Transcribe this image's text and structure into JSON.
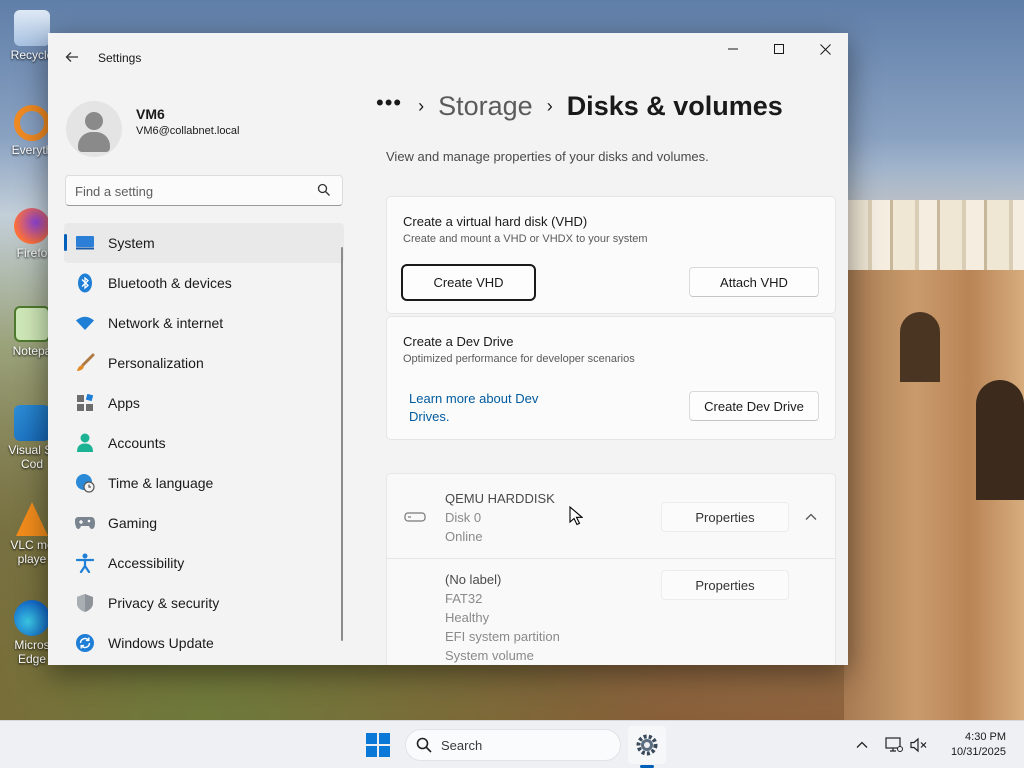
{
  "desktop": {
    "icons": [
      {
        "name": "recycle-bin",
        "label": "Recycle"
      },
      {
        "name": "everything",
        "label": "Everyth"
      },
      {
        "name": "firefox",
        "label": "Firefo"
      },
      {
        "name": "notepad",
        "label": "Notepa"
      },
      {
        "name": "vscode",
        "label": "Visual St Cod"
      },
      {
        "name": "vlc",
        "label": "VLC me playe"
      },
      {
        "name": "edge",
        "label": "Micros Edge"
      }
    ]
  },
  "window": {
    "title": "Settings",
    "controls": {
      "minimize": "–",
      "maximize": "☐",
      "close": "✕"
    }
  },
  "user": {
    "name": "VM6",
    "email": "VM6@collabnet.local"
  },
  "search": {
    "placeholder": "Find a setting"
  },
  "nav": {
    "selected": "System",
    "items": [
      {
        "label": "System",
        "icon": "system-icon"
      },
      {
        "label": "Bluetooth & devices",
        "icon": "bluetooth-icon"
      },
      {
        "label": "Network & internet",
        "icon": "wifi-icon"
      },
      {
        "label": "Personalization",
        "icon": "brush-icon"
      },
      {
        "label": "Apps",
        "icon": "apps-icon"
      },
      {
        "label": "Accounts",
        "icon": "accounts-icon"
      },
      {
        "label": "Time & language",
        "icon": "globe-clock-icon"
      },
      {
        "label": "Gaming",
        "icon": "gamepad-icon"
      },
      {
        "label": "Accessibility",
        "icon": "accessibility-icon"
      },
      {
        "label": "Privacy & security",
        "icon": "shield-icon"
      },
      {
        "label": "Windows Update",
        "icon": "update-icon"
      }
    ]
  },
  "breadcrumb": {
    "overflow": "•••",
    "separator": "›",
    "parent": "Storage",
    "current": "Disks & volumes"
  },
  "page": {
    "subtitle": "View and manage properties of your disks and volumes."
  },
  "vhd_card": {
    "title": "Create a virtual hard disk (VHD)",
    "description": "Create and mount a VHD or VHDX to your system",
    "create_button": "Create VHD",
    "attach_button": "Attach VHD"
  },
  "dev_drive_card": {
    "title": "Create a Dev Drive",
    "description": "Optimized performance for developer scenarios",
    "learn_more_line1": "Learn more about Dev",
    "learn_more_line2": "Drives.",
    "create_button": "Create Dev Drive"
  },
  "disk": {
    "name": "QEMU HARDDISK",
    "number": "Disk 0",
    "status": "Online",
    "properties_button": "Properties",
    "expanded": true,
    "volumes": [
      {
        "label": "(No label)",
        "filesystem": "FAT32",
        "health": "Healthy",
        "type": "EFI system partition",
        "role": "System volume",
        "properties_button": "Properties"
      }
    ]
  },
  "taskbar": {
    "search_label": "Search",
    "time": "4:30 PM",
    "date": "10/31/2025"
  },
  "colors": {
    "accent": "#005fb8",
    "link": "#005a9e",
    "window_bg": "#f3f3f3"
  }
}
